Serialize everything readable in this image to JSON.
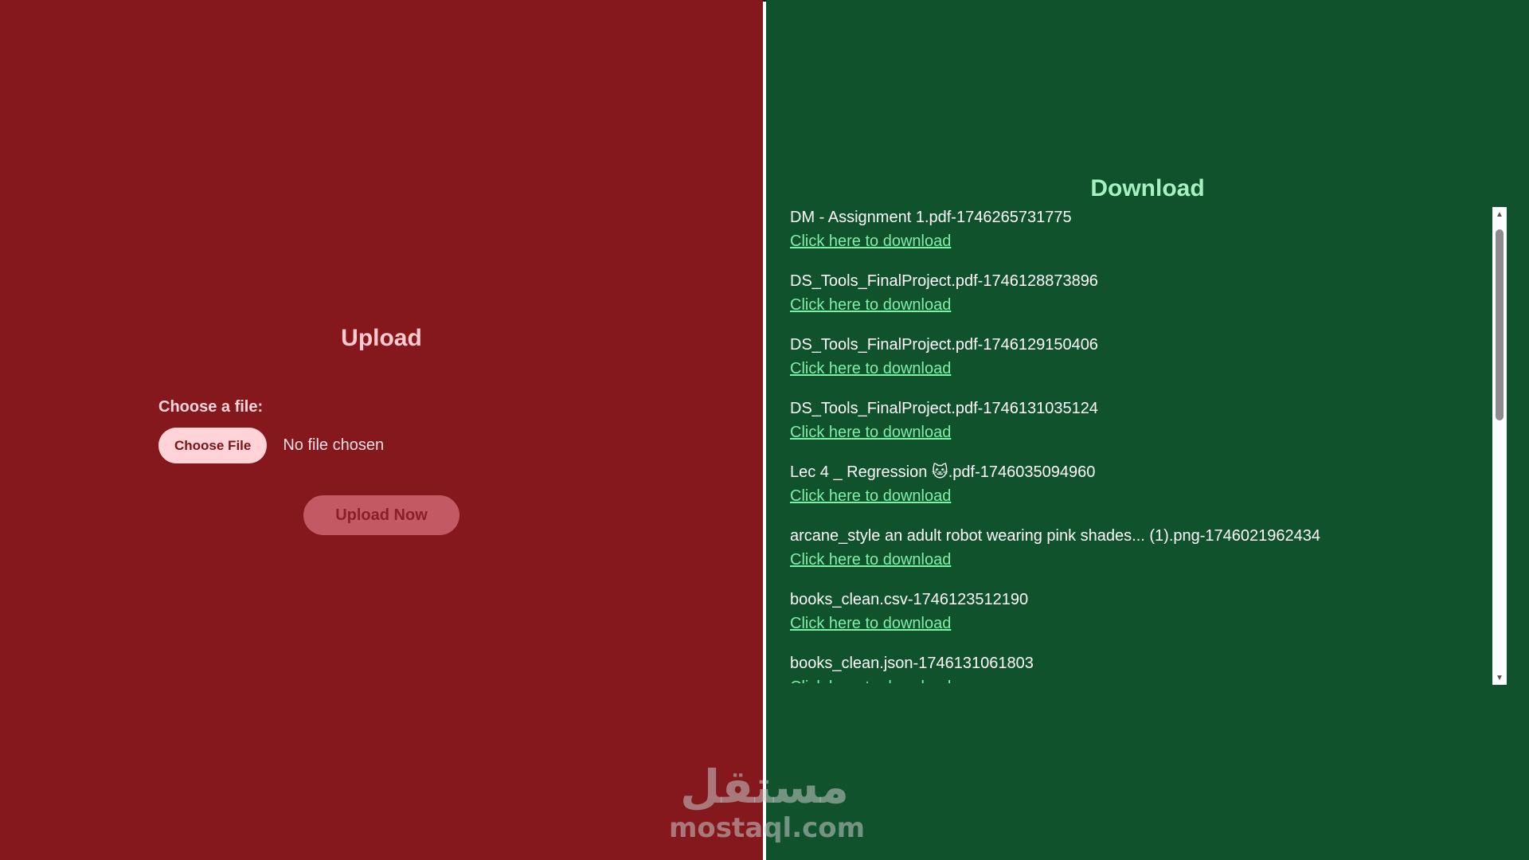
{
  "upload": {
    "title": "Upload",
    "file_label": "Choose a file:",
    "choose_button": "Choose File",
    "file_status": "No file chosen",
    "submit_button": "Upload Now"
  },
  "download": {
    "title": "Download",
    "link_text": "Click here to download",
    "files": [
      "DM - Assignment 1.pdf-1746265731775",
      "DS_Tools_FinalProject.pdf-1746128873896",
      "DS_Tools_FinalProject.pdf-1746129150406",
      "DS_Tools_FinalProject.pdf-1746131035124",
      "Lec 4 _ Regression 🐱.pdf-1746035094960",
      "arcane_style an adult robot wearing pink shades... (1).png-1746021962434",
      "books_clean.csv-1746123512190",
      "books_clean.json-1746131061803"
    ]
  },
  "watermark": {
    "arabic": "مستقل",
    "latin": "mostaql.com"
  },
  "colors": {
    "upload_bg": "#84181c",
    "download_bg": "#0f522c",
    "link": "#7ff0a8"
  }
}
